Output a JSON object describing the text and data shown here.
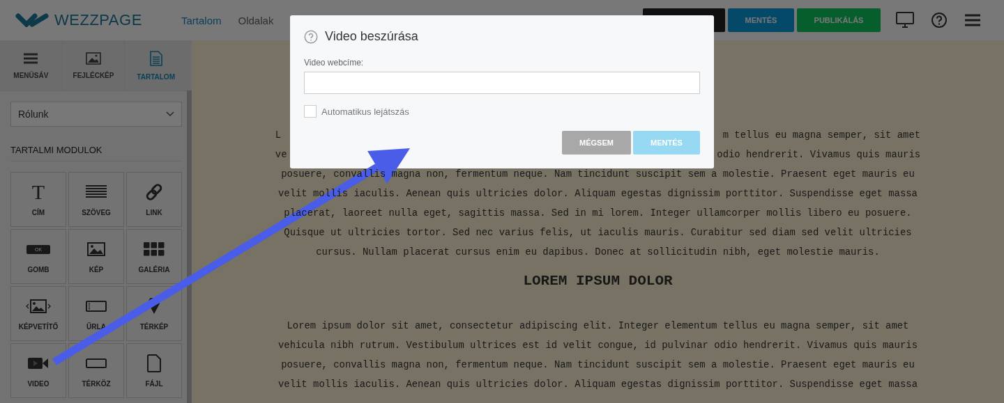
{
  "header": {
    "logo_text": "WEZZPAGE",
    "nav": [
      {
        "label": "Tartalom",
        "selected": true
      },
      {
        "label": "Oldalak",
        "selected": false
      }
    ],
    "buttons": [
      {
        "kind": "blank"
      },
      {
        "kind": "save",
        "label": "MENTÉS"
      },
      {
        "kind": "publish",
        "label": "PUBLIKÁLÁS"
      }
    ]
  },
  "sidebar": {
    "tabs": [
      {
        "label": "MENÜSÁV",
        "kind": "menu",
        "selected": false
      },
      {
        "label": "FEJLÉCKÉP",
        "kind": "image",
        "selected": false
      },
      {
        "label": "TARTALOM",
        "kind": "document",
        "selected": true
      }
    ],
    "page_select": {
      "value": "Rólunk"
    },
    "section_title": "TARTALMI MODULOK",
    "modules": [
      {
        "label": "CÍM",
        "kind": "title",
        "icon_text": "T"
      },
      {
        "label": "SZÖVEG",
        "kind": "text"
      },
      {
        "label": "LINK",
        "kind": "link"
      },
      {
        "label": "GOMB",
        "kind": "button",
        "icon_text": "OK"
      },
      {
        "label": "KÉP",
        "kind": "image"
      },
      {
        "label": "GALÉRIA",
        "kind": "gallery"
      },
      {
        "label": "KÉPVETÍTŐ",
        "kind": "slider"
      },
      {
        "label": "ŰRLA",
        "kind": "form"
      },
      {
        "label": "TÉRKÉP",
        "kind": "map"
      },
      {
        "label": "VIDEO",
        "kind": "video"
      },
      {
        "label": "TÉRKÖZ",
        "kind": "spacer"
      },
      {
        "label": "FÁJL",
        "kind": "file"
      }
    ]
  },
  "content": {
    "blocks": [
      {
        "kind": "paragraph",
        "lines": [
          {
            "left": "L",
            "right": "m tellus eu magna semper, sit amet"
          },
          {
            "left": "ve",
            "right": "odio hendrerit. Vivamus quis mauris"
          },
          {
            "text": "posuere, convallis magna non, fermentum neque. Nam tincidunt suscipit sem a molestie. Praesent eget mauris eu"
          },
          {
            "text": "velit mollis iaculis. Aenean quis ultricies dolor. Aliquam egestas dignissim porttitor. Suspendisse eget massa"
          },
          {
            "text": "placerat, laoreet nulla eget, sagittis massa. Sed in mi lorem. Integer ullamcorper mollis libero eu posuere."
          },
          {
            "text": "Quisque ut ultricies tortor. Sed nec varius felis, ut iaculis mauris. Curabitur sed diam sed velit ultricies"
          },
          {
            "text": "cursus. Nullam placerat cursus enim eu dapibus. Donec at sollicitudin nibh, eget molestie mauris."
          }
        ]
      },
      {
        "kind": "heading",
        "text": "LOREM IPSUM DOLOR"
      },
      {
        "kind": "paragraph",
        "lines": [
          {
            "text": "Lorem ipsum dolor sit amet, consectetur adipiscing elit. Integer elementum tellus eu magna semper, sit amet"
          },
          {
            "text": "vehicula nibh rutrum. Vestibulum ultrices est id velit congue, id pulvinar odio hendrerit. Vivamus quis mauris"
          },
          {
            "text": "posuere, convallis magna non, fermentum neque. Nam tincidunt suscipit sem a molestie. Praesent eget mauris eu"
          },
          {
            "text": "velit mollis iaculis. Aenean quis ultricies dolor. Aliquam egestas dignissim porttitor. Suspendisse eget massa"
          }
        ]
      }
    ]
  },
  "dialog": {
    "title": "Video beszúrása",
    "field_label": "Video webcíme:",
    "autoplay": {
      "label": "Automatikus lejátszás",
      "checked": false
    },
    "buttons": [
      {
        "kind": "cancel",
        "label": "MÉGSEM",
        "disabled": false
      },
      {
        "kind": "save",
        "label": "MENTÉS",
        "disabled": true
      }
    ]
  }
}
